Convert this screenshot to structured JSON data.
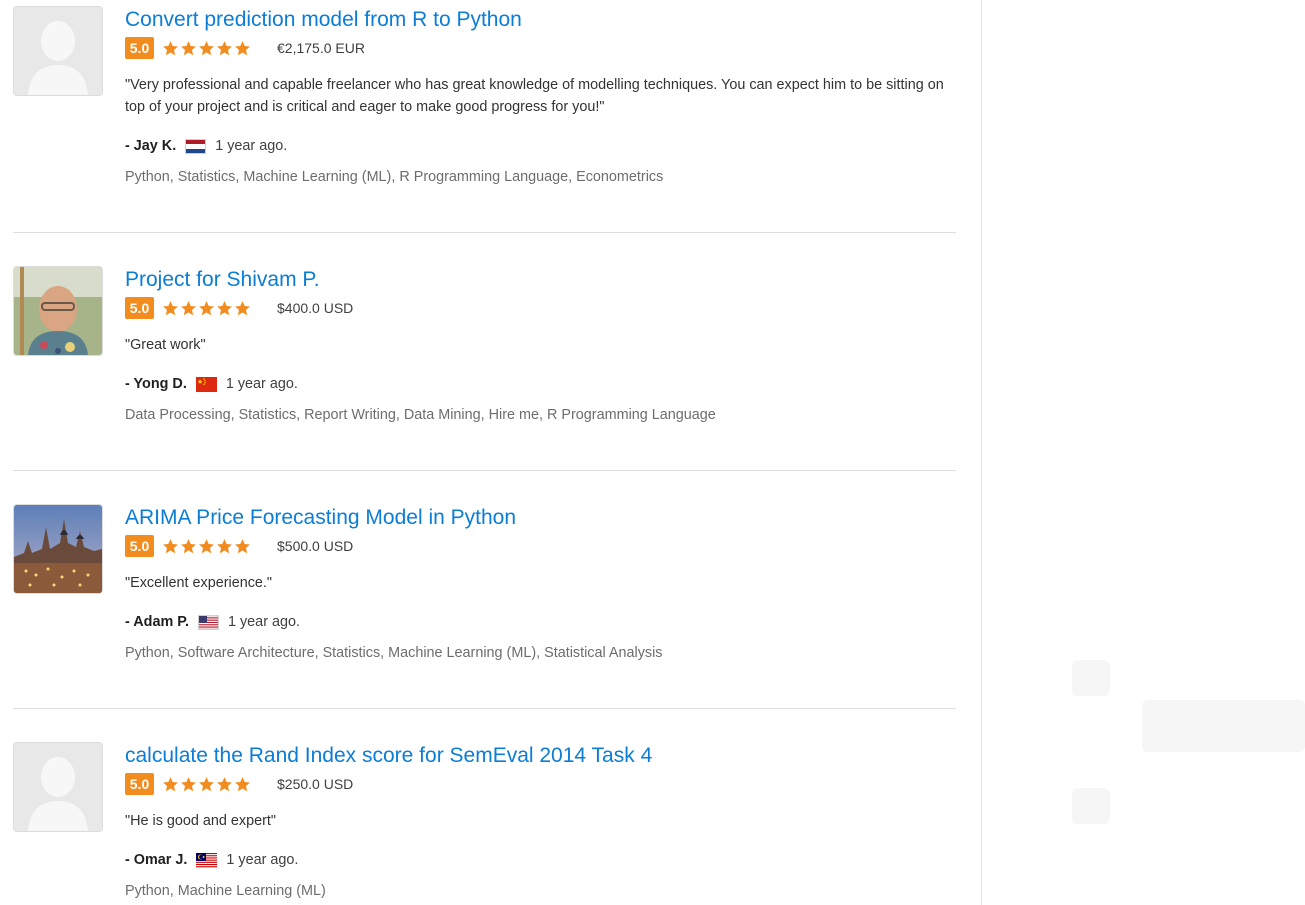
{
  "reviews": [
    {
      "title": "Convert prediction model from R to Python",
      "rating": "5.0",
      "stars": 5,
      "amount": "€2,175.0 EUR",
      "quote": "\"Very professional and capable freelancer who has great knowledge of modelling techniques. You can expect him to be sitting on top of your project and is critical and eager to make good progress for you!\"",
      "author": "- Jay K.",
      "flag": "netherlands-flag-icon",
      "ago": "1 year ago.",
      "skills": "Python, Statistics, Machine Learning (ML), R Programming Language, Econometrics",
      "avatar": "default-avatar-icon"
    },
    {
      "title": "Project for Shivam P.",
      "rating": "5.0",
      "stars": 5,
      "amount": "$400.0 USD",
      "quote": "\"Great work\"",
      "author": "- Yong D.",
      "flag": "china-flag-icon",
      "ago": "1 year ago.",
      "skills": "Data Processing, Statistics, Report Writing, Data Mining, Hire me, R Programming Language",
      "avatar": "user-photo-avatar"
    },
    {
      "title": "ARIMA Price Forecasting Model in Python",
      "rating": "5.0",
      "stars": 5,
      "amount": "$500.0 USD",
      "quote": "\"Excellent experience.\"",
      "author": "- Adam P.",
      "flag": "usa-flag-icon",
      "ago": "1 year ago.",
      "skills": "Python, Software Architecture, Statistics, Machine Learning (ML), Statistical Analysis",
      "avatar": "city-photo-avatar"
    },
    {
      "title": "calculate the Rand Index score for SemEval 2014 Task 4",
      "rating": "5.0",
      "stars": 5,
      "amount": "$250.0 USD",
      "quote": "\"He is good and expert\"",
      "author": "- Omar J.",
      "flag": "malaysia-flag-icon",
      "ago": "1 year ago.",
      "skills": "Python, Machine Learning (ML)",
      "avatar": "default-avatar-icon"
    }
  ],
  "colors": {
    "link": "#0b7dd6",
    "badge": "#f28c1e",
    "star": "#f28c1e",
    "divider": "#dedede"
  }
}
